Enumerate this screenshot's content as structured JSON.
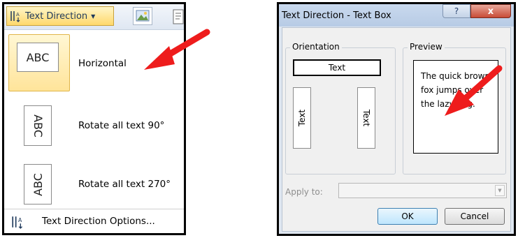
{
  "ribbon": {
    "text_direction_button": "Text Direction",
    "icons": {
      "text_direction": "text-direction-icon",
      "image": "picture-icon",
      "dropdown": "chevron-down-icon"
    }
  },
  "menu": {
    "items": [
      {
        "preview": "ABC",
        "label": "Horizontal",
        "selected": true
      },
      {
        "preview": "ABC",
        "label": "Rotate all text 90°",
        "selected": false
      },
      {
        "preview": "ABC",
        "label": "Rotate all text 270°",
        "selected": false
      }
    ],
    "options_label": "Text Direction Options..."
  },
  "dialog": {
    "title": "Text Direction - Text Box",
    "help_button": "?",
    "close_button": "x",
    "orientation": {
      "title": "Orientation",
      "horizontal": "Text",
      "rotate_90": "Text",
      "rotate_270": "Text"
    },
    "preview": {
      "title": "Preview",
      "line1": "The quick brown",
      "line2": "fox jumps over",
      "line3": "the lazy dog."
    },
    "apply_to": {
      "label": "Apply to:",
      "value": ""
    },
    "ok_button": "OK",
    "cancel_button": "Cancel"
  },
  "annotation": {
    "arrow_color": "#ee1c1c"
  }
}
